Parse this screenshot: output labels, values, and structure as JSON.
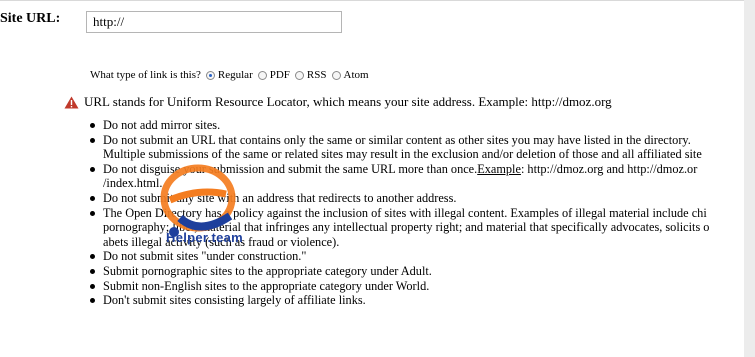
{
  "form": {
    "site_url_label": "Site URL:",
    "site_url_value": "http://"
  },
  "link_type": {
    "question": "What type of link is this?",
    "options": [
      {
        "label": "Regular",
        "checked": true
      },
      {
        "label": "PDF",
        "checked": false
      },
      {
        "label": "RSS",
        "checked": false
      },
      {
        "label": "Atom",
        "checked": false
      }
    ]
  },
  "info": {
    "icon": "warning-icon",
    "text": "URL stands for Uniform Resource Locator, which means your site address. Example: http://dmoz.org"
  },
  "rules": {
    "r1": "Do not add mirror sites.",
    "r2_line1": "Do not submit an URL that contains only the same or similar content as other sites you may have listed in the directory.",
    "r2_line2": "Multiple submissions of the same or related sites may result in the exclusion and/or deletion of those and all affiliated site",
    "r3_pre": "Do not disguise your submission and submit the same URL more than once.",
    "r3_link": "Example",
    "r3_post": ": http://dmoz.org and http://dmoz.or",
    "r3_line2": "/index.html.",
    "r4": "Do not submit any site with an address that redirects to another address.",
    "r5_line1": "The Open Directory has a policy against the inclusion of sites with illegal content. Examples of illegal material include chi",
    "r5_line2": "pornography; libel; material that infringes any intellectual property right; and material that specifically advocates, solicits o",
    "r5_line3": "abets illegal activity (such as fraud or violence).",
    "r6": "Do not submit sites \"under construction.\"",
    "r7": "Submit pornographic sites to the appropriate category under Adult.",
    "r8": "Submit non-English sites to the appropriate category under World.",
    "r9": "Don't submit sites consisting largely of affiliate links."
  },
  "watermark": {
    "text": "Helper.team",
    "colors": {
      "orange": "#f47d20",
      "blue": "#1e3f9c"
    }
  },
  "colors": {
    "radio_selected": "#2a64c8",
    "warning": "#c0392b"
  }
}
